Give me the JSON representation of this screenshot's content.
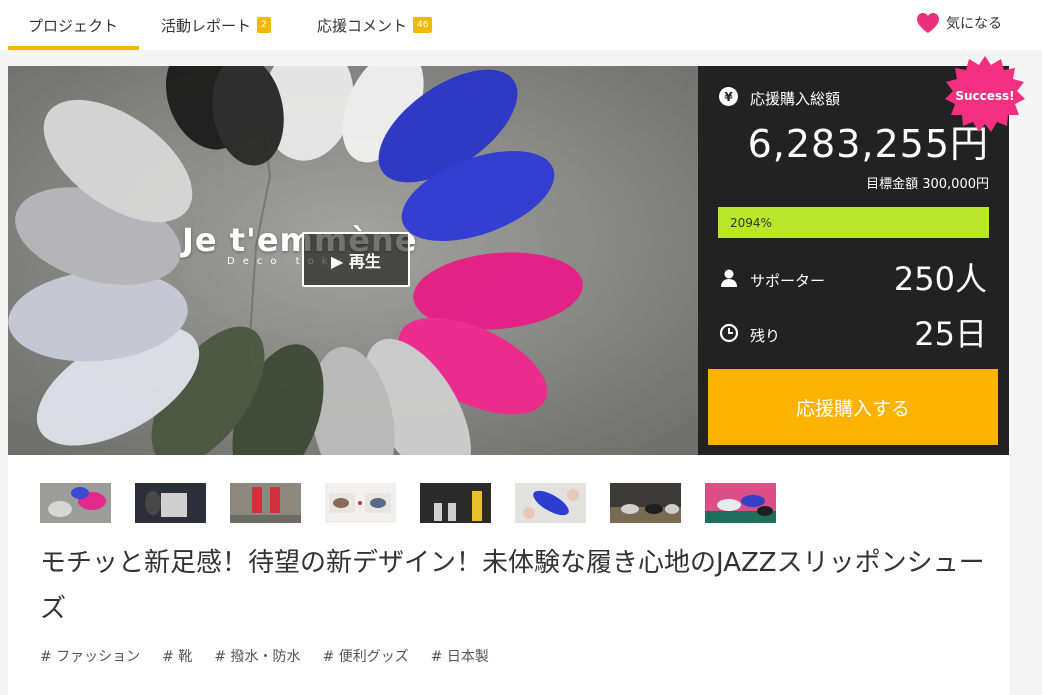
{
  "nav": {
    "tabs": [
      {
        "label": "プロジェクト",
        "badge": ""
      },
      {
        "label": "活動レポート",
        "badge": "2"
      },
      {
        "label": "応援コメント",
        "badge": "46"
      }
    ],
    "favorite_label": "気になる"
  },
  "hero": {
    "brand": "Je t'emmène",
    "brand_sub": "Deco tokyo",
    "play_label": "▶ 再生"
  },
  "panel": {
    "total_label": "応援購入総額",
    "total_amount": "6,283,255円",
    "goal": "目標金額 300,000円",
    "progress_label": "2094%",
    "progress_fraction": 1.0,
    "supporters_label": "サポーター",
    "supporters_value": "250人",
    "remaining_label": "残り",
    "remaining_value": "25日",
    "cta_label": "応援購入する",
    "status_badge": "Success!"
  },
  "thumbnails": [
    "thumb-1",
    "thumb-2",
    "thumb-3",
    "thumb-4",
    "thumb-5",
    "thumb-6",
    "thumb-7",
    "thumb-8"
  ],
  "project": {
    "title": "モチッと新足感！待望の新デザイン！未体験な履き心地のJAZZスリッポンシューズ",
    "tags": [
      "# ファッション",
      "# 靴",
      "# 撥水・防水",
      "# 便利グッズ",
      "# 日本製"
    ]
  },
  "colors": {
    "accent": "#f5b800",
    "cta": "#fcb300",
    "progress": "#b8e629",
    "success_badge": "#f2307f",
    "panel_bg": "#222222"
  }
}
